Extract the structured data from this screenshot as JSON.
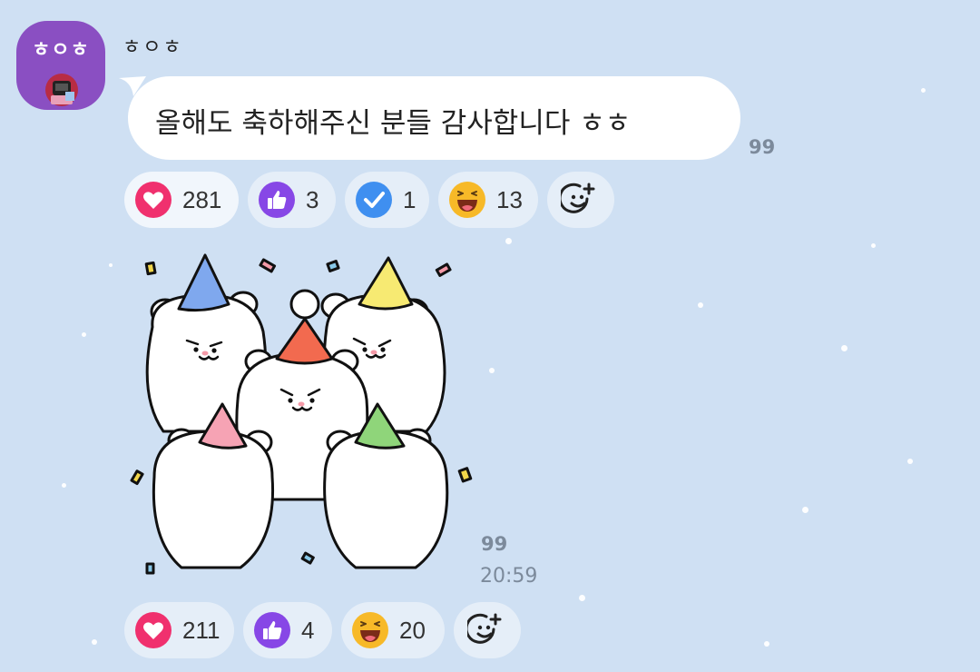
{
  "message": {
    "avatar_text": "ㅎㅇㅎ",
    "sender_name": "ㅎㅇㅎ",
    "text": "올해도 축하해주신 분들 감사합니다 ㅎㅎ",
    "unread_count": "99",
    "reactions": [
      {
        "type": "heart-icon",
        "count": "281"
      },
      {
        "type": "thumbs-up-icon",
        "count": "3"
      },
      {
        "type": "check-icon",
        "count": "1"
      },
      {
        "type": "laughing-face-icon",
        "count": "13"
      }
    ]
  },
  "sticker_message": {
    "unread_count": "99",
    "time": "20:59",
    "reactions": [
      {
        "type": "heart-icon",
        "count": "211"
      },
      {
        "type": "thumbs-up-icon",
        "count": "4"
      },
      {
        "type": "laughing-face-icon",
        "count": "20"
      }
    ]
  },
  "colors": {
    "background": "#cfe0f3",
    "avatar": "#8a4fc2",
    "heart": "#f0306e",
    "thumbs": "#8747e6",
    "check": "#3f8ff0"
  }
}
